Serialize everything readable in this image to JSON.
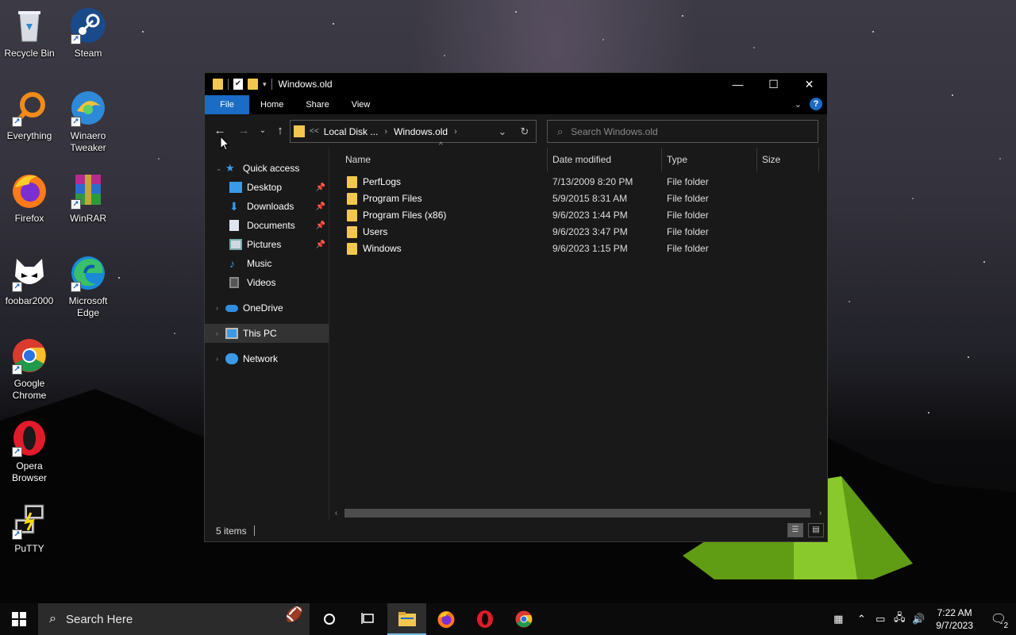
{
  "desktop": {
    "icons": [
      {
        "label": "Recycle Bin",
        "icon": "recycle-bin-icon"
      },
      {
        "label": "Steam",
        "icon": "steam-icon"
      },
      {
        "label": "Everything",
        "icon": "everything-search-icon"
      },
      {
        "label": "Winaero Tweaker",
        "icon": "winaero-tweaker-icon"
      },
      {
        "label": "Firefox",
        "icon": "firefox-icon"
      },
      {
        "label": "WinRAR",
        "icon": "winrar-icon"
      },
      {
        "label": "foobar2000",
        "icon": "foobar2000-icon"
      },
      {
        "label": "Microsoft Edge",
        "icon": "edge-icon"
      },
      {
        "label": "Google Chrome",
        "icon": "chrome-icon"
      },
      {
        "label": "Opera Browser",
        "icon": "opera-icon"
      },
      {
        "label": "PuTTY",
        "icon": "putty-icon"
      }
    ]
  },
  "explorer": {
    "title": "Windows.old",
    "ribbon_tabs": {
      "file": "File",
      "home": "Home",
      "share": "Share",
      "view": "View"
    },
    "help_label": "?",
    "address": {
      "crumb1": "Local Disk ...",
      "crumb2": "Windows.old",
      "overflow": "<<"
    },
    "search_placeholder": "Search Windows.old",
    "nav": {
      "quick_access": "Quick access",
      "desktop": "Desktop",
      "downloads": "Downloads",
      "documents": "Documents",
      "pictures": "Pictures",
      "music": "Music",
      "videos": "Videos",
      "onedrive": "OneDrive",
      "this_pc": "This PC",
      "network": "Network"
    },
    "columns": {
      "name": "Name",
      "date": "Date modified",
      "type": "Type",
      "size": "Size"
    },
    "files": [
      {
        "name": "PerfLogs",
        "date": "7/13/2009 8:20 PM",
        "type": "File folder"
      },
      {
        "name": "Program Files",
        "date": "5/9/2015 8:31 AM",
        "type": "File folder"
      },
      {
        "name": "Program Files (x86)",
        "date": "9/6/2023 1:44 PM",
        "type": "File folder"
      },
      {
        "name": "Users",
        "date": "9/6/2023 3:47 PM",
        "type": "File folder"
      },
      {
        "name": "Windows",
        "date": "9/6/2023 1:15 PM",
        "type": "File folder"
      }
    ],
    "status": "5 items"
  },
  "taskbar": {
    "search_placeholder": "Search Here",
    "time": "7:22 AM",
    "date": "9/7/2023",
    "notification_count": "2"
  },
  "colors": {
    "accent": "#1a6cc4",
    "folder": "#f3c74f",
    "window_bg": "#191919"
  }
}
